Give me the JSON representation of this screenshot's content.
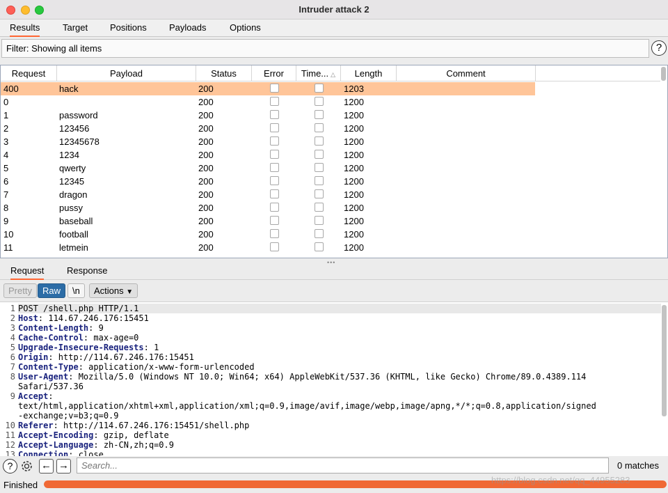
{
  "window": {
    "title": "Intruder attack 2"
  },
  "main_tabs": [
    "Results",
    "Target",
    "Positions",
    "Payloads",
    "Options"
  ],
  "filter": {
    "text": "Filter: Showing all items"
  },
  "help_label": "?",
  "table": {
    "columns": [
      "Request",
      "Payload",
      "Status",
      "Error",
      "Time...",
      "Length",
      "Comment"
    ],
    "rows": [
      {
        "request": "400",
        "payload": "hack",
        "status": "200",
        "length": "1203"
      },
      {
        "request": "0",
        "payload": "",
        "status": "200",
        "length": "1200"
      },
      {
        "request": "1",
        "payload": "password",
        "status": "200",
        "length": "1200"
      },
      {
        "request": "2",
        "payload": "123456",
        "status": "200",
        "length": "1200"
      },
      {
        "request": "3",
        "payload": "12345678",
        "status": "200",
        "length": "1200"
      },
      {
        "request": "4",
        "payload": "1234",
        "status": "200",
        "length": "1200"
      },
      {
        "request": "5",
        "payload": "qwerty",
        "status": "200",
        "length": "1200"
      },
      {
        "request": "6",
        "payload": "12345",
        "status": "200",
        "length": "1200"
      },
      {
        "request": "7",
        "payload": "dragon",
        "status": "200",
        "length": "1200"
      },
      {
        "request": "8",
        "payload": "pussy",
        "status": "200",
        "length": "1200"
      },
      {
        "request": "9",
        "payload": "baseball",
        "status": "200",
        "length": "1200"
      },
      {
        "request": "10",
        "payload": "football",
        "status": "200",
        "length": "1200"
      },
      {
        "request": "11",
        "payload": "letmein",
        "status": "200",
        "length": "1200"
      }
    ]
  },
  "sub_tabs": [
    "Request",
    "Response"
  ],
  "toolbar": {
    "pretty": "Pretty",
    "raw": "Raw",
    "newline": "\\n",
    "actions": "Actions"
  },
  "editor": {
    "lines": [
      {
        "num": "1",
        "key": "",
        "val": "POST /shell.php HTTP/1.1"
      },
      {
        "num": "2",
        "key": "Host",
        "val": ": 114.67.246.176:15451"
      },
      {
        "num": "3",
        "key": "Content-Length",
        "val": ": 9"
      },
      {
        "num": "4",
        "key": "Cache-Control",
        "val": ": max-age=0"
      },
      {
        "num": "5",
        "key": "Upgrade-Insecure-Requests",
        "val": ": 1"
      },
      {
        "num": "6",
        "key": "Origin",
        "val": ": http://114.67.246.176:15451"
      },
      {
        "num": "7",
        "key": "Content-Type",
        "val": ": application/x-www-form-urlencoded"
      },
      {
        "num": "8",
        "key": "User-Agent",
        "val": ": Mozilla/5.0 (Windows NT 10.0; Win64; x64) AppleWebKit/537.36 (KHTML, like Gecko) Chrome/89.0.4389.114"
      },
      {
        "num": "",
        "key": "",
        "val": "Safari/537.36"
      },
      {
        "num": "9",
        "key": "Accept",
        "val": ":"
      },
      {
        "num": "",
        "key": "",
        "val": "text/html,application/xhtml+xml,application/xml;q=0.9,image/avif,image/webp,image/apng,*/*;q=0.8,application/signed"
      },
      {
        "num": "",
        "key": "",
        "val": "-exchange;v=b3;q=0.9"
      },
      {
        "num": "10",
        "key": "Referer",
        "val": ": http://114.67.246.176:15451/shell.php"
      },
      {
        "num": "11",
        "key": "Accept-Encoding",
        "val": ": gzip, deflate"
      },
      {
        "num": "12",
        "key": "Accept-Language",
        "val": ": zh-CN,zh;q=0.9"
      },
      {
        "num": "13",
        "key": "Connection",
        "val": ": close"
      }
    ]
  },
  "search": {
    "placeholder": "Search...",
    "matches": "0 matches"
  },
  "status": {
    "text": "Finished",
    "progress": 1.0
  },
  "watermark": "https://blog.csdn.net/qq_44955283",
  "colors": {
    "accent": "#ff6633",
    "selected_row": "#ffc599",
    "raw_button": "#2c6ca6",
    "progress": "#f06935"
  }
}
